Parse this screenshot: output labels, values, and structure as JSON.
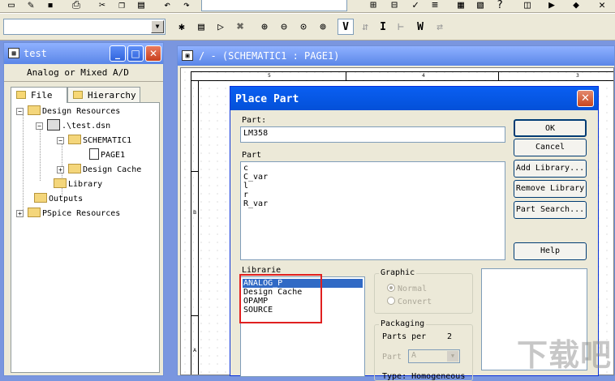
{
  "schematic_window": {
    "title": "/ - (SCHEMATIC1 : PAGE1)",
    "zone_labels_top": [
      "5",
      "4",
      "3"
    ],
    "zone_labels_left": [
      "B",
      "A"
    ]
  },
  "toolbar": {
    "tool_labels": [
      "V",
      "I",
      "W"
    ]
  },
  "project_manager": {
    "title": "test",
    "mode": "Analog or Mixed A/D",
    "tabs": [
      "File",
      "Hierarchy"
    ],
    "tree": {
      "design_resources": "Design Resources",
      "design_file": ".\\test.dsn",
      "schematic": "SCHEMATIC1",
      "page": "PAGE1",
      "design_cache": "Design Cache",
      "library": "Library",
      "outputs": "Outputs",
      "pspice_resources": "PSpice Resources"
    }
  },
  "place_part": {
    "title": "Place Part",
    "part_label": "Part:",
    "part_value": "LM358",
    "part_list_label": "Part",
    "parts": [
      "c",
      "C_var",
      "l",
      "r",
      "R_var"
    ],
    "libraries_label": "Librarie",
    "libraries": [
      "ANALOG_P",
      "Design Cache",
      "OPAMP",
      "SOURCE"
    ],
    "selected_library": "ANALOG_P",
    "buttons": {
      "ok": "OK",
      "cancel": "Cancel",
      "add_library": "Add Library...",
      "remove_library": "Remove Library",
      "part_search": "Part Search...",
      "help": "Help"
    },
    "graphic": {
      "label": "Graphic",
      "normal": "Normal",
      "convert": "Convert"
    },
    "packaging": {
      "label": "Packaging",
      "parts_per_label": "Parts per",
      "parts_per_value": "2",
      "part_label": "Part",
      "part_value": "A",
      "type_label": "Type: Homogeneous"
    }
  },
  "watermark": "下载吧",
  "colors": {
    "title_blue": "#0a5ff2",
    "selection": "#316ac5",
    "highlight_box": "#e02020"
  }
}
